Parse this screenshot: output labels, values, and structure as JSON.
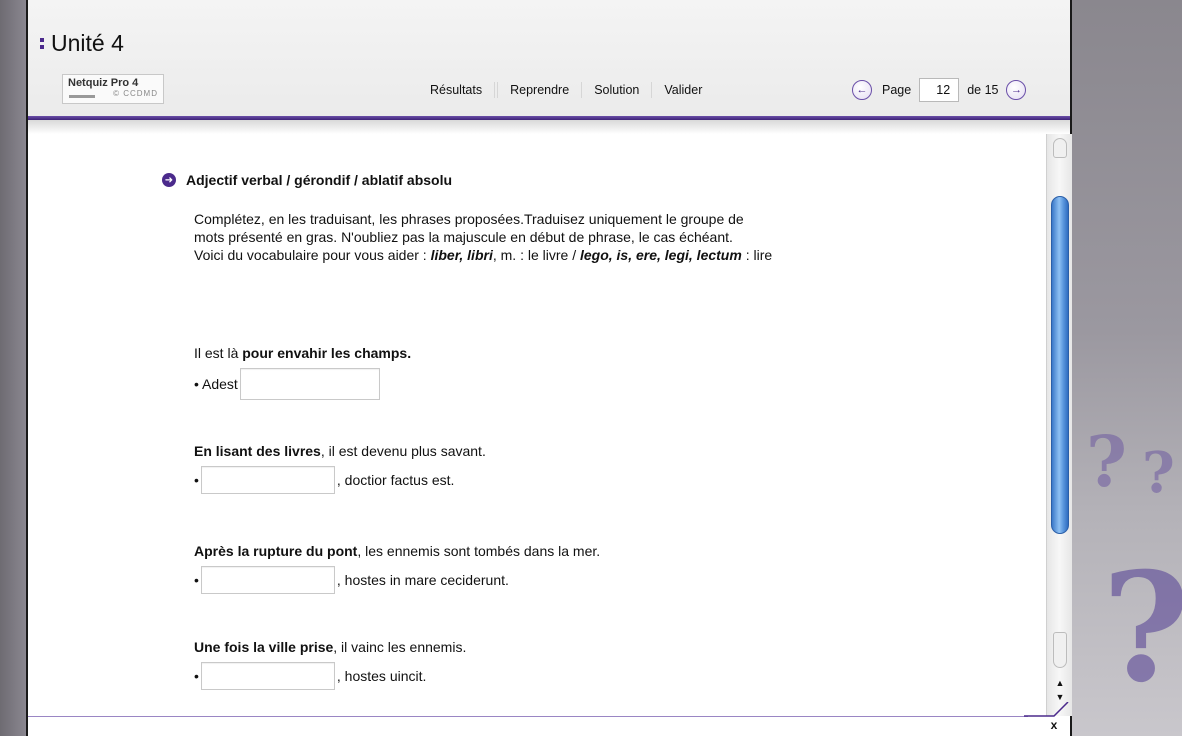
{
  "header": {
    "title": "Unité 4",
    "logo": {
      "name": "Netquiz Pro 4",
      "sub": "© CCDMD"
    }
  },
  "toolbar": {
    "results": "Résultats",
    "restart": "Reprendre",
    "solution": "Solution",
    "validate": "Valider"
  },
  "pager": {
    "prev_icon": "arrow-left-icon",
    "label": "Page",
    "current": "12",
    "of_label": "de 15",
    "next_icon": "arrow-right-icon"
  },
  "section": {
    "icon": "arrow-circle-icon",
    "title": "Adjectif verbal / gérondif / ablatif absolu",
    "instructions": {
      "line1": "Complétez, en les traduisant, les phrases proposées.Traduisez uniquement le groupe de",
      "line2": "mots présenté en gras. N'oubliez pas la majuscule en début de phrase, le cas échéant.",
      "line3_prefix": "Voici du vocabulaire pour vous aider : ",
      "vocab1": "liber, libri",
      "vocab1_gender": ", m. : le livre / ",
      "vocab2": "lego, is, ere, legi, lectum",
      "vocab2_suffix": " : lire"
    }
  },
  "questions": [
    {
      "prompt_plain_before": "Il est là ",
      "prompt_bold": "pour envahir les champs.",
      "prompt_plain_after": "",
      "answer_prefix": "• Adest",
      "answer_suffix": "",
      "value": ""
    },
    {
      "prompt_plain_before": "",
      "prompt_bold": "En lisant des livres",
      "prompt_plain_after": ", il est devenu plus savant.",
      "answer_prefix": "•",
      "answer_suffix": ", doctior factus est.",
      "value": ""
    },
    {
      "prompt_plain_before": "",
      "prompt_bold": "Après la rupture du pont",
      "prompt_plain_after": ", les ennemis sont tombés dans la mer.",
      "answer_prefix": "•",
      "answer_suffix": ", hostes in mare ceciderunt.",
      "value": ""
    },
    {
      "prompt_plain_before": "",
      "prompt_bold": "Une fois la ville prise",
      "prompt_plain_after": ", il vainc les ennemis.",
      "answer_prefix": "•",
      "answer_suffix": ", hostes uincit.",
      "value": ""
    }
  ],
  "footer": {
    "close": "x"
  },
  "colors": {
    "accent": "#4b2a8c",
    "scroll_thumb": "#5c98de"
  }
}
